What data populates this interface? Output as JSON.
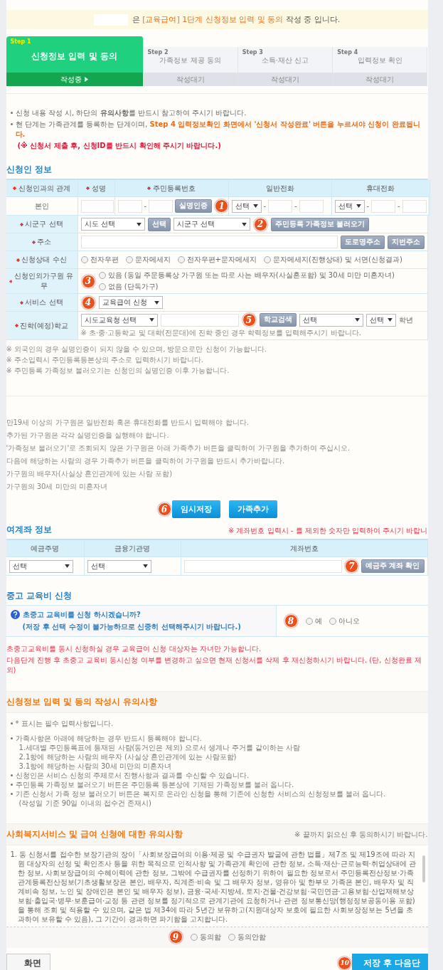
{
  "banner": {
    "segments": [
      {
        "text": "은 ",
        "highlight": false
      },
      {
        "text": "[교육급여] 1단계 신청정보 입력 및 동의",
        "highlight": true
      },
      {
        "text": " 작성 중 입니다.",
        "highlight": false
      }
    ]
  },
  "steps": [
    {
      "step": "Step 1",
      "title": "신청정보 입력 및 동의",
      "status": "작성중",
      "selected": true
    },
    {
      "step": "Step 2",
      "title": "가족정보 제공 동의",
      "status": "작성대기",
      "selected": false
    },
    {
      "step": "Step 3",
      "title": "소득·재산 신고",
      "status": "작성대기",
      "selected": false
    },
    {
      "step": "Step 4",
      "title": "입력정보 확인",
      "status": "작성대기",
      "selected": false
    }
  ],
  "notices": [
    {
      "bullet": true,
      "segments": [
        {
          "text": "신청 내용 작성 시, 하단의 **유의사항**를 반드시 참고하여 주시기 바랍니다.",
          "kind": "normal"
        }
      ]
    },
    {
      "bullet": true,
      "segments": [
        {
          "text": "현 단계는 가족관계를 등록하는 단계이며, ",
          "kind": "normal"
        },
        {
          "text": "Step 4 입력정보확인 화면에서 '신청서 작성완료' 버튼을 누르셔야 신청이 완료됩니다.",
          "kind": "emphasis"
        }
      ]
    },
    {
      "bullet": false,
      "segments": [
        {
          "text": "(※ 신청서 제출 후, 신청ID를 반드시 확인해 주시기 바랍니다.)",
          "kind": "warning"
        }
      ]
    }
  ],
  "applicant": {
    "title": "신청인 정보",
    "columns": [
      {
        "label": "신청인과의 관계",
        "required": true
      },
      {
        "label": "성명",
        "required": true
      },
      {
        "label": "주민등록번호",
        "required": true
      },
      {
        "label": "일반전화",
        "required": false
      },
      {
        "label": "휴대전화",
        "required": false
      }
    ],
    "row": [
      {
        "controls": [
          {
            "kind": "text",
            "text": "본인"
          }
        ]
      },
      {
        "controls": [
          {
            "kind": "input"
          }
        ]
      },
      {
        "controls": [
          {
            "kind": "input-short"
          },
          {
            "kind": "text",
            "text": "-"
          },
          {
            "kind": "input-short"
          },
          {
            "kind": "button",
            "label": "실명인증"
          },
          {
            "kind": "marker",
            "text": "1"
          }
        ]
      },
      {
        "controls": [
          {
            "kind": "select-narrow",
            "value": "선택"
          },
          {
            "kind": "text",
            "text": "-"
          },
          {
            "kind": "input-short"
          },
          {
            "kind": "text",
            "text": "-"
          },
          {
            "kind": "input-short"
          }
        ]
      },
      {
        "controls": [
          {
            "kind": "select-narrow",
            "value": "선택"
          },
          {
            "kind": "text",
            "text": "-"
          },
          {
            "kind": "input-short"
          },
          {
            "kind": "text",
            "text": "-"
          },
          {
            "kind": "input-short"
          }
        ]
      }
    ]
  },
  "form_rows": [
    {
      "label": "시군구 선택",
      "required": true,
      "controls": [
        {
          "kind": "select",
          "value": "시도 선택"
        },
        {
          "kind": "button",
          "label": "선택"
        },
        {
          "kind": "select-wide",
          "value": "시군구 선택"
        },
        {
          "kind": "marker",
          "text": "2"
        },
        {
          "kind": "button",
          "label": "주민등록 가족정보 불러오기"
        }
      ]
    },
    {
      "label": "주소",
      "required": true,
      "controls": [
        {
          "kind": "input-fill"
        },
        {
          "kind": "button",
          "label": "도로명주소"
        },
        {
          "kind": "button",
          "label": "지번주소"
        }
      ]
    },
    {
      "label": "신청상태 수신",
      "required": true,
      "controls": [
        {
          "kind": "radios",
          "stacked": false,
          "options": [
            {
              "label": "전자우편",
              "selected": false
            },
            {
              "label": "문자메세지",
              "selected": false
            },
            {
              "label": "전자우편+문자메세지",
              "selected": false
            },
            {
              "label": "문자메세지(진행상태) 및 서면(신청결과)",
              "selected": false
            }
          ]
        }
      ]
    },
    {
      "label": "신청인외가구원 유무",
      "required": true,
      "controls": [
        {
          "kind": "marker",
          "text": "3"
        },
        {
          "kind": "radios",
          "stacked": true,
          "options": [
            {
              "label": "있음 (동일 주문등록상 가구원 또는 따로 사는 배우자(사실혼포함) 및 30세 미만 미혼자녀)",
              "selected": false
            },
            {
              "label": "없음 (단독가구)",
              "selected": false
            }
          ]
        }
      ]
    },
    {
      "label": "서비스 선택",
      "required": true,
      "controls": [
        {
          "kind": "marker",
          "text": "4"
        },
        {
          "kind": "select",
          "value": "교육급여 신청"
        }
      ]
    },
    {
      "label": "진학(예정)학교",
      "required": true,
      "controls": [
        {
          "kind": "select-wide",
          "value": "시도교육청 선택"
        },
        {
          "kind": "input-wide"
        },
        {
          "kind": "marker",
          "text": "5"
        },
        {
          "kind": "button",
          "label": "학교검색"
        },
        {
          "kind": "select",
          "value": "선택"
        },
        {
          "kind": "select-narrow",
          "value": "선택"
        },
        {
          "kind": "text",
          "text": "학년"
        }
      ],
      "note": "※ 초·중·고등학교 및 대학(전문대)에 진학 중인 경우 학력정보를 입력해주시기 바랍니다."
    }
  ],
  "footnotes": [
    "※ 외국인의 경우 실명인증이 되지 않을 수 있으며, 방문으로만 신청이 가능합니다.",
    "※ 주소입력시 주민등록등본상의 주소로 입력하시기 바랍니다.",
    "※ 주민등록 가족정보 불러오기는 신청인의 실명인증 이후 가능합니다."
  ],
  "guidance": [
    "만19세 이상의 가구원은 일반전화 혹은 휴대전화를 반드시 입력해야 합니다.",
    "추가된 가구원은 각각 실명인증을 실행해야 합니다.",
    "'가족정보 불러오기'로 조회되지 않은 가구원은 아래 가족추가 버튼을 클릭하여 가구원을 추가하여 주십시오.",
    "다음에 해당하는 사람의 경우 가족추가 버튼을 클릭하여 가구원을 반드시 추가바랍니다.",
    "가구원의 배우자(사실상 혼인관계에 있는 사람 포함)",
    "가구원의 30세 미만의 미혼자녀"
  ],
  "actions": [
    {
      "label": "임시저장",
      "marker": "6"
    },
    {
      "label": "가족추가"
    }
  ],
  "account": {
    "title": "여계좌 정보",
    "note": "※ 계좌번호 입력시 - 를 제외한 숫자만 입력하여 주시기 바랍니",
    "columns": [
      {
        "label": "예금주명",
        "required": false
      },
      {
        "label": "금융기관명",
        "required": false
      },
      {
        "label": "계좌번호",
        "required": false
      }
    ],
    "row": [
      {
        "controls": [
          {
            "kind": "select",
            "value": "선택"
          }
        ]
      },
      {
        "controls": [
          {
            "kind": "select",
            "value": "선택"
          }
        ]
      },
      {
        "controls": [
          {
            "kind": "input-fill"
          },
          {
            "kind": "marker",
            "text": "7"
          },
          {
            "kind": "button",
            "label": "예금주 계좌 확인"
          }
        ]
      }
    ]
  },
  "school_fee": {
    "title": "중고 교육비 신청",
    "question": "초중고 교육비를 신청 하시겠습니까?",
    "caution": "(저장 후 선택 수정이 불가능하므로 신중히 선택해주시기 바랍니다.)",
    "marker": "8",
    "options": [
      {
        "label": "예",
        "selected": false
      },
      {
        "label": "아니오",
        "selected": false
      }
    ],
    "notes": [
      "초중고교육비를 동시 신청하실 경우 교육급여 신청 대상자는 자녀만 가능합니다.",
      "다음단계 진행 후 초중고 교육비 동시신청 여부를 변경하고 싶으면 현재 신청서를 삭제 후 재신청하시기 바랍니다. (단, 신청완료 제외)"
    ]
  },
  "cautions": {
    "title": "신청정보 입력 및 동의 작성시 유의사항",
    "items": [
      {
        "kind": "lead",
        "text": "* 표시는 필수 입력사항입니다."
      },
      {
        "kind": "bullet",
        "text": "가족사항은 아래에 해당하는 경우 반드시 등록해야 합니다."
      },
      {
        "kind": "sub",
        "text": "1.세대별 주민등록표에 등재된 사람(동거인은 제외) 으로서 생계나 주거를 같이하는 사람"
      },
      {
        "kind": "sub",
        "text": "2.1항에 해당하는 사람의 배우자 (사실상 혼인관계에 있는 사람포함)"
      },
      {
        "kind": "sub",
        "text": "3.1항에 해당하는 사람의 30세 미만의 미혼자녀"
      },
      {
        "kind": "bullet",
        "text": "신청인은 서비스 신청의 주체로서 진행사항과 결과를 수신할 수 있습니다."
      },
      {
        "kind": "bullet",
        "text": "주민등록 가족정보 불러오기 버튼은 주민등록 등본상에 기재된 가족정보를 불러 옵니다."
      },
      {
        "kind": "bullet",
        "text": "기존 신청서 가족 정보 불러오기 버튼은 복지로 온라인 신청을 통해 기존에 신청한 서비스의 신청정보를 불러 옵니다."
      },
      {
        "kind": "sub",
        "text": "(작성일 기준 90일 이내의 접수건 존재시)"
      }
    ]
  },
  "welfare": {
    "title": "사회복지서비스 및 급여 신청에 대한 유의사항",
    "note": "※ 끝까지 읽으신 후 동의하시기 바랍니다.",
    "paragraph": "1. 동 신청서를 접수한 보장기관의 장이「사회보장급여의 이용·제공 및 수급권자 발굴에 관한 법률」제7조 및 제19조에 따라 지원 대상자의 선정 및 확인조사 등을 위한 목적으로 인적사항 및 가족관계 확인에 관한 정보, 소득·재산·근로능력·취업상태에 관한 정보, 사회보장급여의 수혜이력에 관한 정보, 그밖에 수급권자를 선정하기 위하여 필요한 정보로서 주민등록전산정보·가족관계등록전산정보(기초생활보장은 본인, 배우자, 직계존·비속 및 그 배우자 정보, 영유아 및 한부모 가족은 본인, 배우자 및 직계비속 정보, 노인 및 장애인은 본인 및 배우자 정보), 금융·국세·지방세, 토지·건물·건강보험·국민연금·고용보험·산업재해보상보험·출입국·병무·보훈급여·교정 등 관련 정보를 정기적으로 관계기관에 요청하거나 관련 정보통신망(행정정보공동이용 포함)을 통해 조회 및 적용할 수 있으며, 같은 법 제34에 따라 5년간 보유하고(지원대상자 보호에 필요한 사회보장정보는 5년을 초과하여 보유할 수 있음), 그 기간이 경과하면 파기함을 고지합니다."
  },
  "agreement": {
    "marker": "9",
    "options": [
      {
        "label": "동의함",
        "selected": false
      },
      {
        "label": "동의안함",
        "selected": false
      }
    ]
  },
  "footer": {
    "back": "화면",
    "next": "저장 후 다음단",
    "next_marker": "10"
  }
}
